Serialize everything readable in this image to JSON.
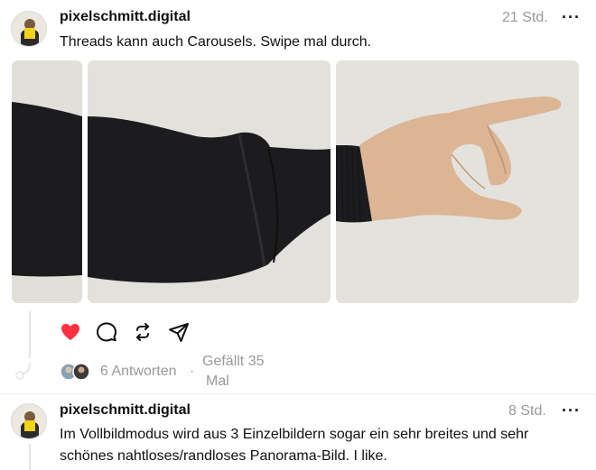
{
  "post1": {
    "username": "pixelschmitt.digital",
    "time": "21 Std.",
    "more_label": "···",
    "text": "Threads kann auch Carousels. Swipe mal durch.",
    "liked": true,
    "replies_label": "6 Antworten",
    "separator": "·",
    "likes_label_line1": "Gefällt 35",
    "likes_label_line2": "Mal"
  },
  "post2": {
    "username": "pixelschmitt.digital",
    "time": "8 Std.",
    "more_label": "···",
    "text": "Im Vollbildmodus wird aus 3 Einzelbildern sogar ein sehr breites und sehr schönes nahtloses/randloses Panorama-Bild. I like."
  },
  "colors": {
    "like_red": "#ff3040",
    "muted": "#999999",
    "panel_background": "#e3e1dc",
    "sleeve": "#1c1c1e",
    "skin": "#dcb595"
  },
  "icons": [
    "heart-icon",
    "comment-icon",
    "repost-icon",
    "share-icon",
    "more-icon"
  ]
}
